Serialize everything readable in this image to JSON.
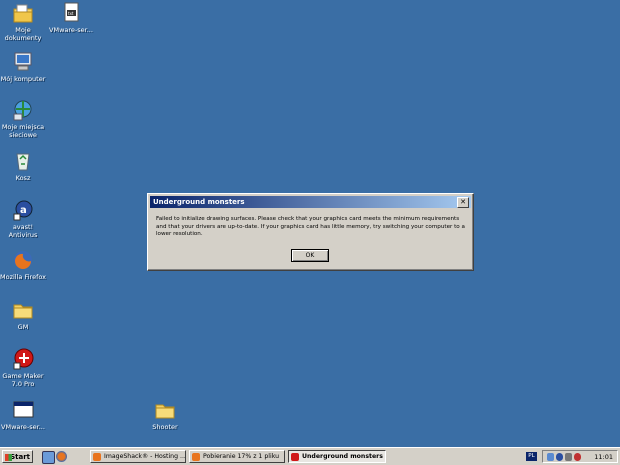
{
  "desktop": {
    "icons": [
      {
        "label": "Moje\ndokumenty",
        "icon": "my-documents-icon"
      },
      {
        "label": "VMware-ser...",
        "icon": "vmware-text-file-icon"
      },
      {
        "label": "Mój komputer",
        "icon": "my-computer-icon"
      },
      {
        "label": "Moje miejsca\nsieciowe",
        "icon": "network-places-icon"
      },
      {
        "label": "Kosz",
        "icon": "recycle-bin-icon"
      },
      {
        "label": "avast!\nAntivirus",
        "icon": "avast-icon"
      },
      {
        "label": "Mozilla Firefox",
        "icon": "firefox-icon"
      },
      {
        "label": "GM",
        "icon": "folder-icon"
      },
      {
        "label": "Game Maker\n7.0 Pro",
        "icon": "game-maker-icon"
      },
      {
        "label": "VMware-ser...",
        "icon": "vmware-window-icon"
      },
      {
        "label": "Shooter",
        "icon": "folder-icon"
      }
    ]
  },
  "dialog": {
    "title": "Underground monsters",
    "close_label": "✕",
    "message": "Failed to initialize drawing surfaces. Please check that your graphics card meets the minimum requirements and that your drivers are up-to-date. If your graphics card has little memory, try switching your computer to a lower resolution.",
    "ok_label": "OK"
  },
  "taskbar": {
    "start_label": "Start",
    "buttons": [
      {
        "label": "ImageShack® - Hosting ...",
        "active": false
      },
      {
        "label": "Pobieranie 17% z 1 pliku",
        "active": false
      },
      {
        "label": "Underground monsters",
        "active": true
      }
    ],
    "language": "PL",
    "clock": "11:01"
  },
  "colors": {
    "desktop": "#3a6ea5",
    "title_gradient_start": "#0a246a",
    "title_gradient_end": "#a6caf0",
    "face": "#d4d0c8"
  }
}
